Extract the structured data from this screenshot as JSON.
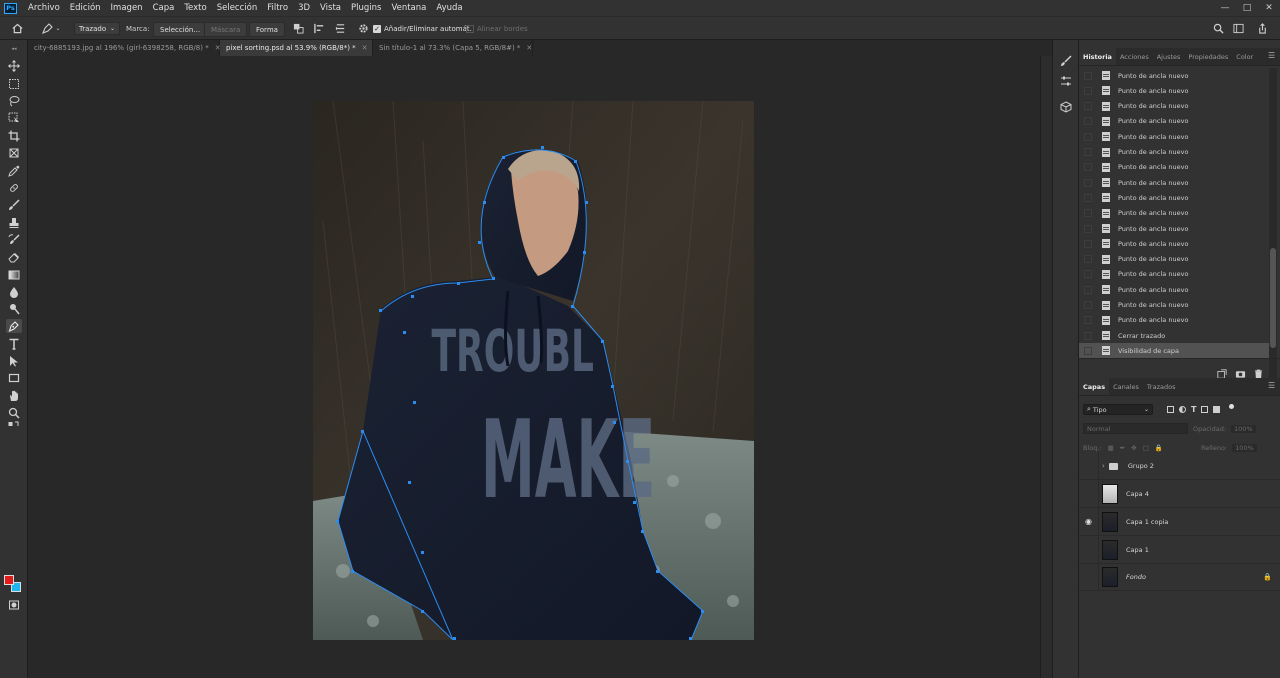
{
  "app": {
    "logo": "Ps"
  },
  "menu": [
    "Archivo",
    "Edición",
    "Imagen",
    "Capa",
    "Texto",
    "Selección",
    "Filtro",
    "3D",
    "Vista",
    "Plugins",
    "Ventana",
    "Ayuda"
  ],
  "window_controls": [
    "minimize-icon",
    "maximize-icon",
    "close-icon"
  ],
  "options_bar": {
    "mode_select": "Trazado",
    "marca_label": "Marca:",
    "seleccion_button": "Selección...",
    "mascara_button": "Máscara",
    "forma_button": "Forma",
    "auto_add_label": "Añadir/Eliminar automát.",
    "auto_add_checked": true,
    "align_edges_label": "Alinear bordes"
  },
  "tabs": [
    {
      "label": "city-6885193.jpg al 196% (girl-6398258, RGB/8) *",
      "active": false
    },
    {
      "label": "pixel sorting.psd al 53.9% (RGB/8*) *",
      "active": true
    },
    {
      "label": "Sin título-1 al 73.3% (Capa 5, RGB/8#) *",
      "active": false
    }
  ],
  "history_panel": {
    "tabs": [
      "Historia",
      "Acciones",
      "Ajustes",
      "Propiedades",
      "Color"
    ],
    "active_tab": "Historia",
    "items": [
      "Punto de ancla nuevo",
      "Punto de ancla nuevo",
      "Punto de ancla nuevo",
      "Punto de ancla nuevo",
      "Punto de ancla nuevo",
      "Punto de ancla nuevo",
      "Punto de ancla nuevo",
      "Punto de ancla nuevo",
      "Punto de ancla nuevo",
      "Punto de ancla nuevo",
      "Punto de ancla nuevo",
      "Punto de ancla nuevo",
      "Punto de ancla nuevo",
      "Punto de ancla nuevo",
      "Punto de ancla nuevo",
      "Punto de ancla nuevo",
      "Punto de ancla nuevo",
      "Cerrar trazado",
      "Visibilidad de capa"
    ],
    "selected_index": 18
  },
  "layers_panel": {
    "tabs": [
      "Capas",
      "Canales",
      "Trazados"
    ],
    "active_tab": "Capas",
    "filter": "Tipo",
    "blend_mode": "Normal",
    "opacity_label": "Opacidad:",
    "opacity_value": "100%",
    "lock_label": "Bloq.:",
    "fill_label": "Relleno:",
    "fill_value": "100%",
    "layers": [
      {
        "name": "Grupo 2",
        "type": "group",
        "visible": false
      },
      {
        "name": "Capa 4",
        "type": "layer",
        "visible": false
      },
      {
        "name": "Capa 1 copia",
        "type": "layer",
        "visible": true
      },
      {
        "name": "Capa 1",
        "type": "layer",
        "visible": false
      },
      {
        "name": "Fondo",
        "type": "background",
        "visible": false,
        "locked": true
      }
    ]
  },
  "colors": {
    "foreground": "#e31b1b",
    "background": "#1fb6f0",
    "path_anchor": "#2c8cf2",
    "active_tool_bg": "#4a4a4a"
  },
  "photo": {
    "shirt_text_1": "TROUBL",
    "shirt_text_2": "MAKE"
  }
}
